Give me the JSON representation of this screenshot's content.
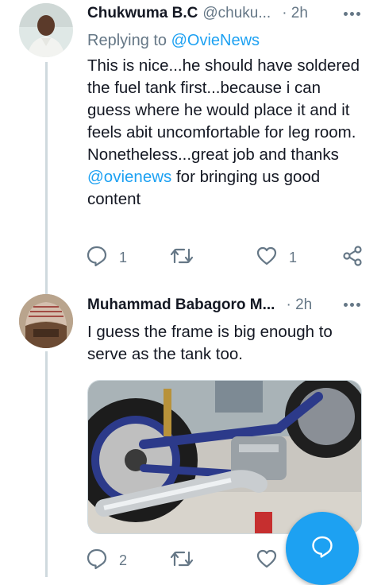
{
  "tweet1": {
    "name": "Chukwuma B.C",
    "handle": "@chuku...",
    "time": "· 2h",
    "replying_prefix": "Replying to",
    "replying_to": "@OvieNews",
    "text_part1": "This is nice...he should have soldered the fuel tank first...because i can guess where he would place it and it feels abit uncomfortable for leg room.",
    "text_part2": "Nonetheless...great job and thanks",
    "text_link": "@ovienews",
    "text_part3": "for bringing us good content",
    "reply_count": "1",
    "retweet_count": "",
    "like_count": "1"
  },
  "tweet2": {
    "name": "Muhammad Babagoro M...",
    "time": "· 2h",
    "text": "I guess the frame is big enough to serve as the tank too.",
    "reply_count": "2",
    "retweet_count": "",
    "like_count": ""
  },
  "icons": {
    "reply": "reply-icon",
    "retweet": "retweet-icon",
    "like": "heart-icon",
    "share": "share-icon",
    "more": "more-dots-icon",
    "compose": "compose-reply-icon"
  },
  "colors": {
    "accent": "#1da1f2",
    "secondary_text": "#657786",
    "primary_text": "#141823",
    "thread_line": "#cfd9de"
  }
}
